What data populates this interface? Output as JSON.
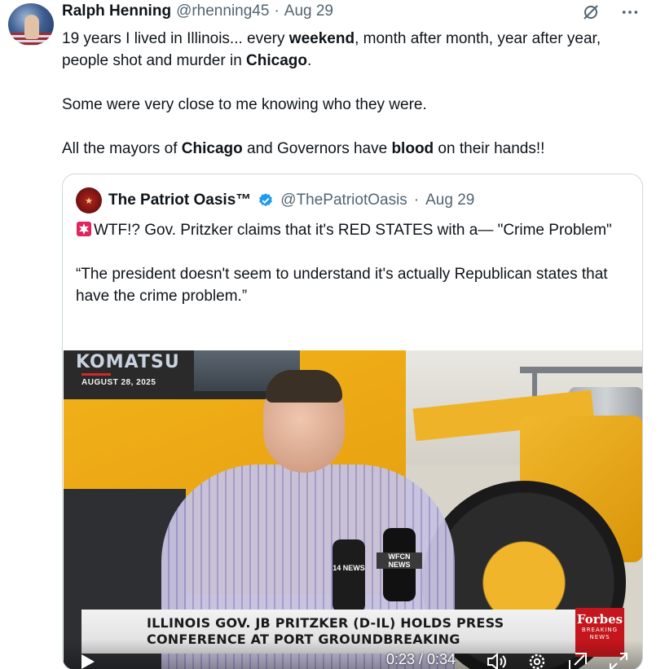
{
  "author": {
    "name": "Ralph Henning",
    "handle": "@rhenning45",
    "separator": "·",
    "date": "Aug 29"
  },
  "icons": {
    "grok": "grok-icon",
    "more": "more-icon"
  },
  "tweet": {
    "p1_a": "19 years I lived in Illinois... every ",
    "p1_b": "weekend",
    "p1_c": ", month after month, year after year, people shot and murder in ",
    "p1_d": "Chicago",
    "p1_e": ".",
    "p2": "Some were very close to me knowing who they were.",
    "p3_a": "All the mayors of ",
    "p3_b": "Chicago",
    "p3_c": " and Governors have ",
    "p3_d": "blood",
    "p3_e": " on their hands!!"
  },
  "quoted": {
    "name": "The Patriot Oasis™",
    "handle": "@ThePatriotOasis",
    "separator": "·",
    "date": "Aug 29",
    "text1": "WTF!? Gov. Pritzker claims that it's RED STATES with a— \"Crime Problem\"",
    "text2": " “The president doesn't seem to understand it's actually Republican states that have the crime problem.”"
  },
  "video": {
    "brand": "KOMATSU",
    "date_overlay": "AUGUST 28, 2025",
    "lower_third_line1": "ILLINOIS GOV. JB PRITZKER (D-IL) HOLDS PRESS",
    "lower_third_line2": "CONFERENCE AT PORT GROUNDBREAKING",
    "forbes_logo": "Forbes",
    "forbes_tag1": "BREAKING",
    "forbes_tag2": "NEWS",
    "mic1": "14 NEWS",
    "mic2": "WFCN NEWS",
    "time": "0:23 / 0:34"
  },
  "colors": {
    "text": "#0f1419",
    "secondary": "#536471",
    "border": "#cfd9de",
    "verified": "#1d9bf0",
    "forbes_red": "#c4161c"
  }
}
